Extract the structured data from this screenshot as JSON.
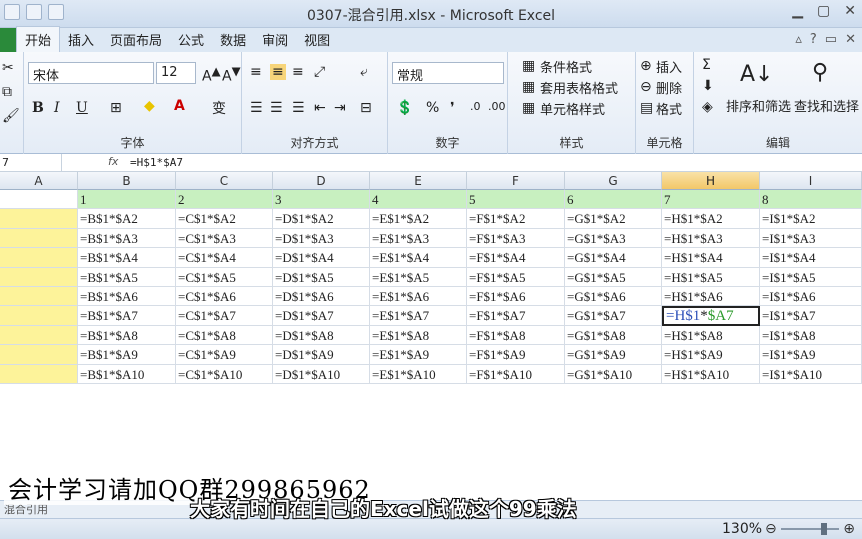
{
  "window": {
    "title": "0307-混合引用.xlsx - Microsoft Excel"
  },
  "tabs": [
    "开始",
    "插入",
    "页面布局",
    "公式",
    "数据",
    "审阅",
    "视图"
  ],
  "ribbon": {
    "font_name": "宋体",
    "font_size": "12",
    "number_format": "常规",
    "groups": [
      "字体",
      "对齐方式",
      "数字",
      "样式",
      "单元格",
      "编辑"
    ],
    "style_items": [
      "条件格式",
      "套用表格格式",
      "单元格样式"
    ],
    "cell_items": [
      "插入",
      "删除",
      "格式"
    ],
    "edit_items": [
      "排序和筛选",
      "查找和选择"
    ]
  },
  "formula_bar": {
    "name_box": "7",
    "formula": "=H$1*$A7"
  },
  "grid": {
    "col_headers": [
      "A",
      "B",
      "C",
      "D",
      "E",
      "F",
      "G",
      "H",
      "I"
    ],
    "row1": [
      "",
      "1",
      "2",
      "3",
      "4",
      "5",
      "6",
      "7",
      "8"
    ],
    "rows": [
      [
        "",
        "=B$1*$A2",
        "=C$1*$A2",
        "=D$1*$A2",
        "=E$1*$A2",
        "=F$1*$A2",
        "=G$1*$A2",
        "=H$1*$A2",
        "=I$1*$A2"
      ],
      [
        "",
        "=B$1*$A3",
        "=C$1*$A3",
        "=D$1*$A3",
        "=E$1*$A3",
        "=F$1*$A3",
        "=G$1*$A3",
        "=H$1*$A3",
        "=I$1*$A3"
      ],
      [
        "",
        "=B$1*$A4",
        "=C$1*$A4",
        "=D$1*$A4",
        "=E$1*$A4",
        "=F$1*$A4",
        "=G$1*$A4",
        "=H$1*$A4",
        "=I$1*$A4"
      ],
      [
        "",
        "=B$1*$A5",
        "=C$1*$A5",
        "=D$1*$A5",
        "=E$1*$A5",
        "=F$1*$A5",
        "=G$1*$A5",
        "=H$1*$A5",
        "=I$1*$A5"
      ],
      [
        "",
        "=B$1*$A6",
        "=C$1*$A6",
        "=D$1*$A6",
        "=E$1*$A6",
        "=F$1*$A6",
        "=G$1*$A6",
        "=H$1*$A6",
        "=I$1*$A6"
      ],
      [
        "",
        "=B$1*$A7",
        "=C$1*$A7",
        "=D$1*$A7",
        "=E$1*$A7",
        "=F$1*$A7",
        "=G$1*$A7",
        "",
        "=I$1*$A7"
      ],
      [
        "",
        "=B$1*$A8",
        "=C$1*$A8",
        "=D$1*$A8",
        "=E$1*$A8",
        "=F$1*$A8",
        "=G$1*$A8",
        "=H$1*$A8",
        "=I$1*$A8"
      ],
      [
        "",
        "=B$1*$A9",
        "=C$1*$A9",
        "=D$1*$A9",
        "=E$1*$A9",
        "=F$1*$A9",
        "=G$1*$A9",
        "=H$1*$A9",
        "=I$1*$A9"
      ],
      [
        "",
        "=B$1*$A10",
        "=C$1*$A10",
        "=D$1*$A10",
        "=E$1*$A10",
        "=F$1*$A10",
        "=G$1*$A10",
        "=H$1*$A10",
        "=I$1*$A10"
      ]
    ],
    "active_cell": {
      "part1": "=H$1",
      "part2": "$A7"
    }
  },
  "overlay": {
    "qq_text": "会计学习请加QQ群299865962",
    "subtitle": "大家有时间在自己的Excel试做这个99乘法"
  },
  "sheet": {
    "tab": "混合引用"
  },
  "status": {
    "zoom": "130%"
  },
  "colors": {
    "accent_green": "#c8f0c0",
    "col_a_yellow": "#fdf39a",
    "selected_header": "#f2c768"
  }
}
